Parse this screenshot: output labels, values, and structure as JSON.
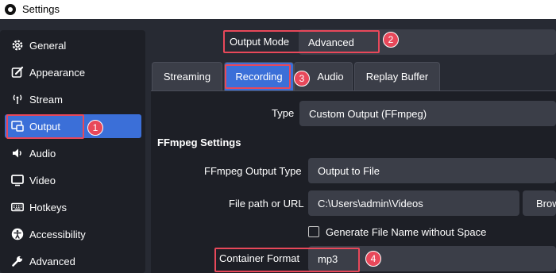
{
  "window": {
    "title": "Settings"
  },
  "sidebar": {
    "items": [
      {
        "label": "General",
        "icon": "gear-icon"
      },
      {
        "label": "Appearance",
        "icon": "paintbrush-icon"
      },
      {
        "label": "Stream",
        "icon": "broadcast-icon"
      },
      {
        "label": "Output",
        "icon": "monitor-output-icon",
        "active": true
      },
      {
        "label": "Audio",
        "icon": "speaker-icon"
      },
      {
        "label": "Video",
        "icon": "display-icon"
      },
      {
        "label": "Hotkeys",
        "icon": "keyboard-icon"
      },
      {
        "label": "Accessibility",
        "icon": "accessibility-icon"
      },
      {
        "label": "Advanced",
        "icon": "wrench-icon"
      }
    ]
  },
  "output_mode": {
    "label": "Output Mode",
    "value": "Advanced"
  },
  "tabs": [
    {
      "label": "Streaming"
    },
    {
      "label": "Recording",
      "active": true
    },
    {
      "label": "Audio"
    },
    {
      "label": "Replay Buffer"
    }
  ],
  "recording": {
    "type_label": "Type",
    "type_value": "Custom Output (FFmpeg)",
    "section_title": "FFmpeg Settings",
    "ffmpeg_output_type_label": "FFmpeg Output Type",
    "ffmpeg_output_type_value": "Output to File",
    "file_path_label": "File path or URL",
    "file_path_value": "C:\\Users\\admin\\Videos",
    "browse_label": "Brow",
    "generate_name_label": "Generate File Name without Space",
    "container_format_label": "Container Format",
    "container_format_value": "mp3"
  },
  "annotations": {
    "step1": "1",
    "step2": "2",
    "step3": "3",
    "step4": "4",
    "highlight_color": "#e8485a"
  },
  "colors": {
    "accent": "#3b6fd8",
    "panel": "#1d1f26",
    "background": "#272a33",
    "field": "#3b3e48"
  }
}
